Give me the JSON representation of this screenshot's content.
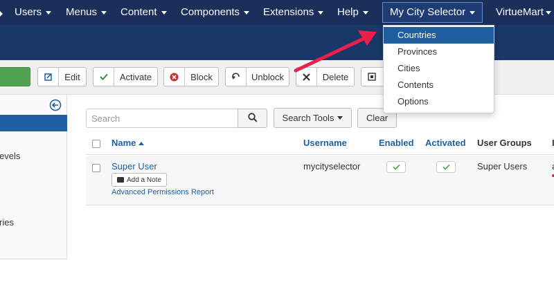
{
  "nav": {
    "items": [
      {
        "label": "Users"
      },
      {
        "label": "Menus"
      },
      {
        "label": "Content"
      },
      {
        "label": "Components"
      },
      {
        "label": "Extensions"
      },
      {
        "label": "Help"
      },
      {
        "label": "My City Selector"
      },
      {
        "label": "VirtueMart"
      }
    ]
  },
  "dropdown": {
    "items": [
      {
        "label": "Countries"
      },
      {
        "label": "Provinces"
      },
      {
        "label": "Cities"
      },
      {
        "label": "Contents"
      },
      {
        "label": "Options"
      }
    ]
  },
  "toolbar": {
    "edit_label": "Edit",
    "activate_label": "Activate",
    "block_label": "Block",
    "unblock_label": "Unblock",
    "delete_label": "Delete"
  },
  "sidebar": {
    "items": [
      {
        "label": "evels"
      },
      {
        "label": "ries"
      }
    ]
  },
  "search": {
    "placeholder": "Search",
    "tools_label": "Search Tools",
    "clear_label": "Clear"
  },
  "table": {
    "headers": {
      "name": "Name",
      "username": "Username",
      "enabled": "Enabled",
      "activated": "Activated",
      "groups": "User Groups",
      "extra": "I"
    },
    "rows": [
      {
        "name": "Super User",
        "note_label": "Add a Note",
        "permissions_link": "Advanced Permissions Report",
        "username": "mycityselector",
        "groups": "Super Users",
        "extra": "a"
      }
    ]
  },
  "colors": {
    "nav_bg": "#1a2f5a",
    "header_bg": "#1a3867",
    "accent": "#1f5fa0",
    "green": "#51a351",
    "annotation_arrow": "#e8204a"
  }
}
